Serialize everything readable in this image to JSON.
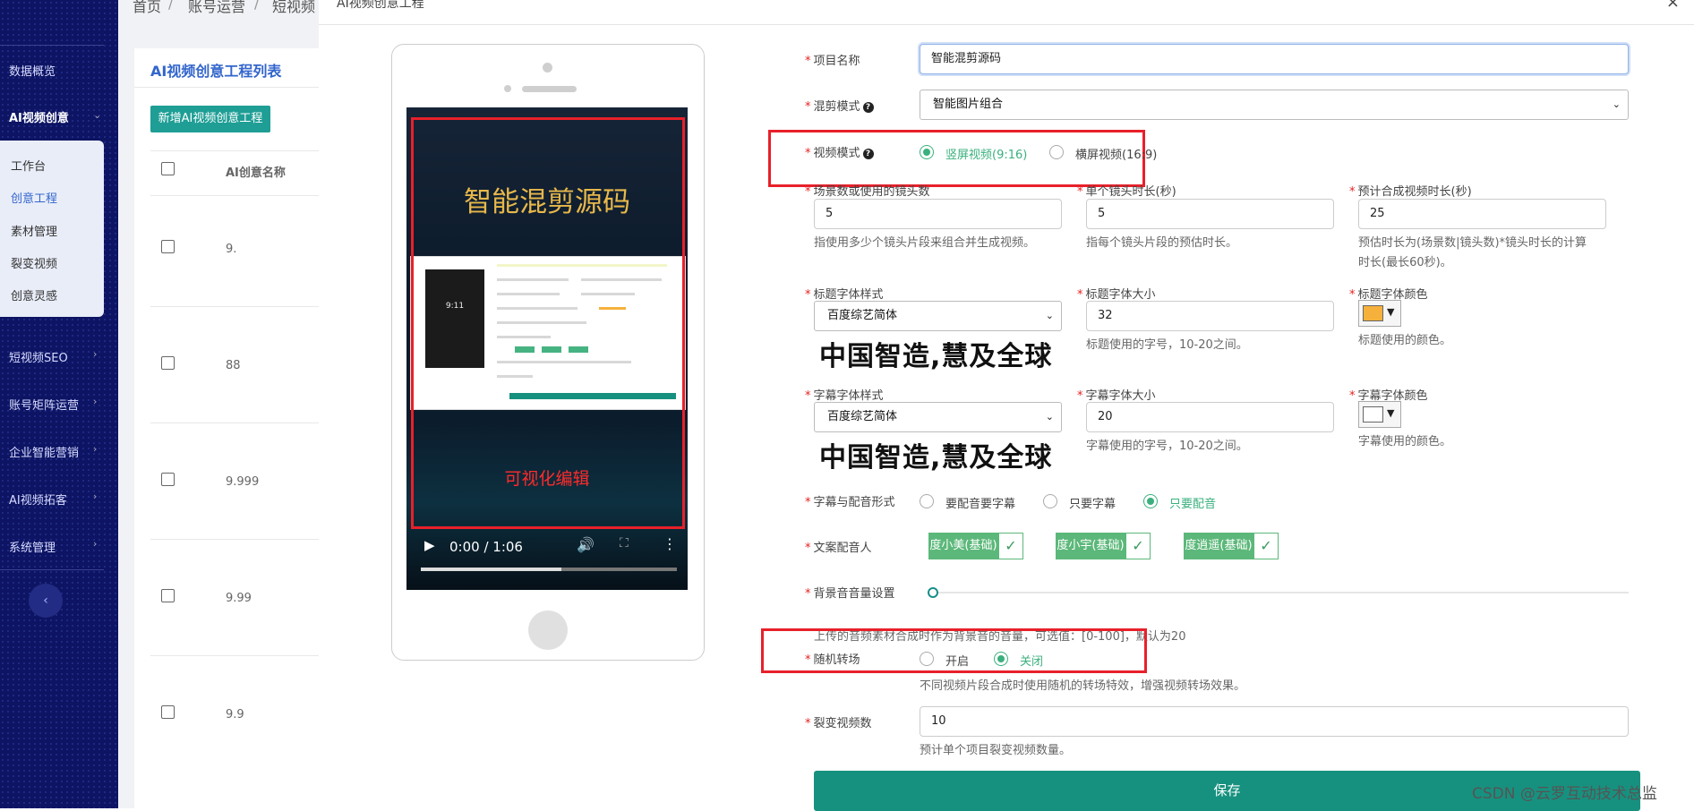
{
  "breadcrumb": [
    "首页",
    "账号运营",
    "短视频"
  ],
  "sidebar": {
    "items": [
      {
        "label": "数据概览"
      },
      {
        "label": "AI视频创意"
      },
      {
        "label": "短视频SEO"
      },
      {
        "label": "账号矩阵运营"
      },
      {
        "label": "企业智能营销"
      },
      {
        "label": "AI视频拓客"
      },
      {
        "label": "系统管理"
      }
    ],
    "submenu": [
      "工作台",
      "创意工程",
      "素材管理",
      "裂变视频",
      "创意灵感"
    ],
    "collapse_icon": "‹"
  },
  "list": {
    "title": "AI视频创意工程列表",
    "add_button": "新增AI视频创意工程",
    "col_name": "AI创意名称",
    "rows": [
      "9.",
      "88",
      "9.999",
      "9.99",
      "9.9"
    ]
  },
  "modal": {
    "title": "AI视频创意工程",
    "close": "×",
    "preview": {
      "title": "智能混剪源码",
      "caption": "可视化编辑",
      "time": "0:00 / 1:06",
      "progress": 0.55,
      "mini_clock": "9:11"
    },
    "form": {
      "project_name": {
        "label": "项目名称",
        "value": "智能混剪源码"
      },
      "mix_mode": {
        "label": "混剪模式",
        "value": "智能图片组合"
      },
      "video_mode": {
        "label": "视频模式",
        "options": [
          "竖屏视频(9:16)",
          "横屏视频(16:9)"
        ],
        "selected": 0
      },
      "scene_count": {
        "label": "场景数或使用的镜头数",
        "value": "5",
        "hint": "指使用多少个镜头片段来组合并生成视频。"
      },
      "clip_duration": {
        "label": "单个镜头时长(秒)",
        "value": "5",
        "hint": "指每个镜头片段的预估时长。"
      },
      "total_duration": {
        "label": "预计合成视频时长(秒)",
        "value": "25",
        "hint1": "预估时长为(场景数|镜头数)*镜头时长的计算",
        "hint2": "时长(最长60秒)。"
      },
      "title_font": {
        "label": "标题字体样式",
        "value": "百度综艺简体",
        "preview": "中国智造,慧及全球"
      },
      "title_size": {
        "label": "标题字体大小",
        "value": "32",
        "hint": "标题使用的字号，10-20之间。"
      },
      "title_color": {
        "label": "标题字体颜色",
        "value": "#f6b13c",
        "hint": "标题使用的颜色。"
      },
      "sub_font": {
        "label": "字幕字体样式",
        "value": "百度综艺简体",
        "preview": "中国智造,慧及全球"
      },
      "sub_size": {
        "label": "字幕字体大小",
        "value": "20",
        "hint": "字幕使用的字号，10-20之间。"
      },
      "sub_color": {
        "label": "字幕字体颜色",
        "value": "#ffffff",
        "hint": "字幕使用的颜色。"
      },
      "sub_audio": {
        "label": "字幕与配音形式",
        "options": [
          "要配音要字幕",
          "只要字幕",
          "只要配音"
        ],
        "selected": 2
      },
      "voice": {
        "label": "文案配音人",
        "options": [
          "度小美(基础)",
          "度小宇(基础)",
          "度逍遥(基础)"
        ]
      },
      "bgm_volume": {
        "label": "背景音音量设置",
        "value": 0,
        "hint": "上传的音频素材合成时作为背景音的音量，可选值：[0-100]，默认为20"
      },
      "random_transition": {
        "label": "随机转场",
        "options": [
          "开启",
          "关闭"
        ],
        "selected": 1,
        "hint": "不同视频片段合成时使用随机的转场特效，增强视频转场效果。"
      },
      "fission_count": {
        "label": "裂变视频数",
        "value": "10",
        "hint": "预计单个项目裂变视频数量。"
      },
      "save": "保存"
    }
  },
  "watermark": "CSDN @云罗互动技术总监",
  "colors": {
    "primary": "#17917f",
    "accent_green": "#3ab07e",
    "sidebar_bg": "#0d1463",
    "highlight_red": "#e8202a"
  }
}
